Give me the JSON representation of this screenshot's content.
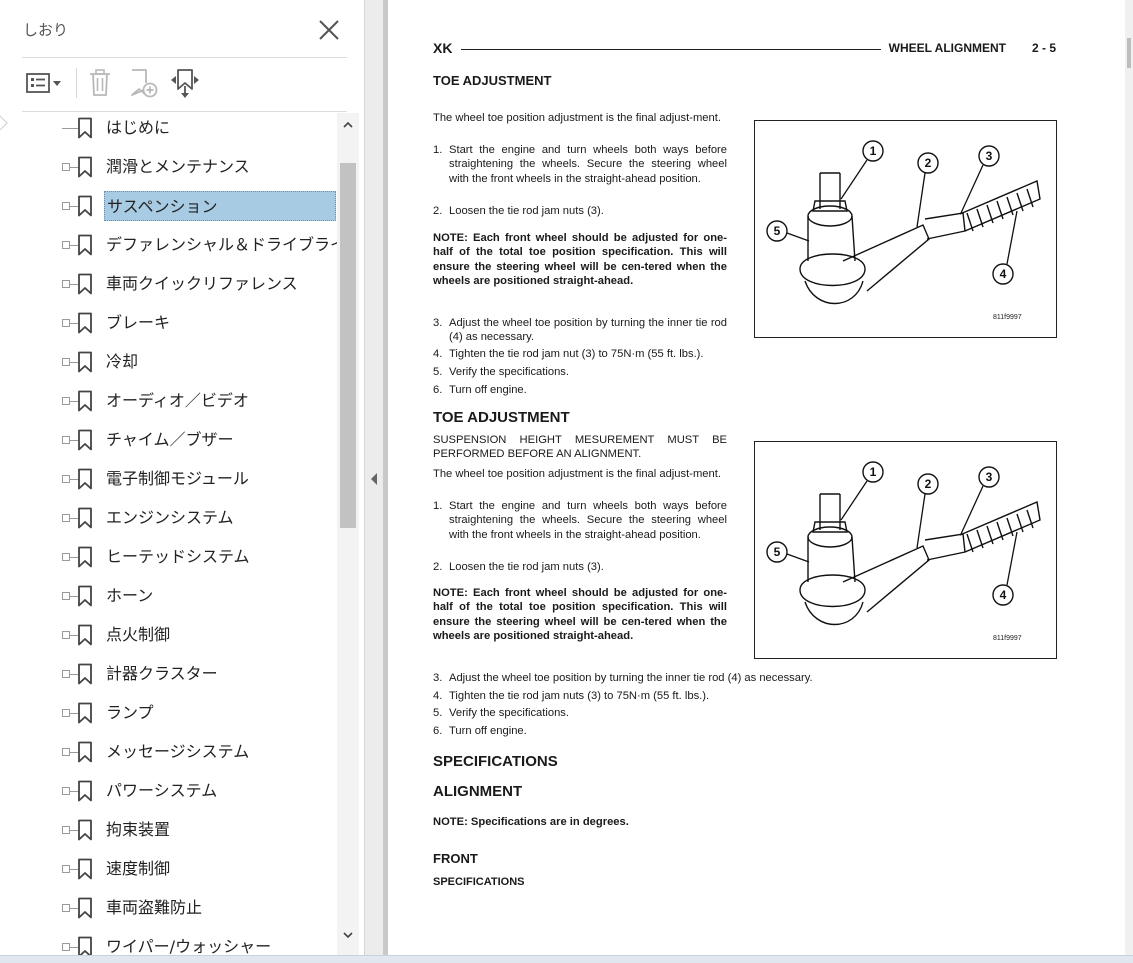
{
  "bookmarks_panel": {
    "title": "しおり",
    "toolbar": {
      "options_icon": "list-options-icon",
      "delete_icon": "trash-icon",
      "new_bookmark_icon": "new-bookmark-icon",
      "expand_icon": "bookmark-expand-icon"
    },
    "items": [
      {
        "label": "はじめに",
        "selected": false
      },
      {
        "label": "潤滑とメンテナンス",
        "selected": false
      },
      {
        "label": "サスペンション",
        "selected": true
      },
      {
        "label": "デファレンシャル＆ドライブライン",
        "selected": false
      },
      {
        "label": "車両クイックリファレンス",
        "selected": false
      },
      {
        "label": "ブレーキ",
        "selected": false
      },
      {
        "label": "冷却",
        "selected": false
      },
      {
        "label": "オーディオ／ビデオ",
        "selected": false
      },
      {
        "label": "チャイム／ブザー",
        "selected": false
      },
      {
        "label": "電子制御モジュール",
        "selected": false
      },
      {
        "label": "エンジンシステム",
        "selected": false
      },
      {
        "label": "ヒーテッドシステム",
        "selected": false
      },
      {
        "label": "ホーン",
        "selected": false
      },
      {
        "label": "点火制御",
        "selected": false
      },
      {
        "label": "計器クラスター",
        "selected": false
      },
      {
        "label": "ランプ",
        "selected": false
      },
      {
        "label": "メッセージシステム",
        "selected": false
      },
      {
        "label": "パワーシステム",
        "selected": false
      },
      {
        "label": "拘束装置",
        "selected": false
      },
      {
        "label": "速度制御",
        "selected": false
      },
      {
        "label": "車両盗難防止",
        "selected": false
      },
      {
        "label": "ワイパー/ウォッシャー",
        "selected": false
      }
    ]
  },
  "document": {
    "header": {
      "model": "XK",
      "section": "WHEEL ALIGNMENT",
      "page": "2 - 5"
    },
    "section1": {
      "heading": "TOE ADJUSTMENT",
      "intro": "The wheel toe position adjustment is the final adjust-ment.",
      "steps_a": [
        {
          "n": "1.",
          "text": "Start the engine and turn wheels both ways before straightening the wheels. Secure the steering wheel with the front wheels in the straight-ahead position."
        },
        {
          "n": "2.",
          "text": "Loosen the tie rod jam nuts (3)."
        }
      ],
      "note": "NOTE: Each front wheel should be adjusted for one-half of the total toe position specification. This will ensure the steering wheel will be cen-tered when the wheels are positioned straight-ahead.",
      "steps_b": [
        {
          "n": "3.",
          "text": "Adjust the wheel toe position by turning the inner tie rod (4) as necessary."
        },
        {
          "n": "4.",
          "text": "Tighten the tie rod jam nut (3) to 75N·m (55 ft. lbs.)."
        },
        {
          "n": "5.",
          "text": "Verify the specifications."
        },
        {
          "n": "6.",
          "text": "Turn off engine."
        }
      ],
      "figure_code": "811f9997"
    },
    "section2": {
      "heading": "TOE ADJUSTMENT",
      "warning": "SUSPENSION HEIGHT MESUREMENT MUST BE PERFORMED BEFORE AN ALIGNMENT.",
      "intro": "The wheel toe position adjustment is the final adjust-ment.",
      "steps_a": [
        {
          "n": "1.",
          "text": "Start the engine and turn wheels both ways before straightening the wheels. Secure the steering wheel with the front wheels in the straight-ahead position."
        },
        {
          "n": "2.",
          "text": "Loosen the tie rod jam nuts (3)."
        }
      ],
      "note": "NOTE: Each front wheel should be adjusted for one-half of the total toe position specification. This will ensure the steering wheel will be cen-tered when the wheels are positioned straight-ahead.",
      "steps_b": [
        {
          "n": "3.",
          "text": "Adjust the wheel toe position by turning the inner tie rod (4) as necessary."
        },
        {
          "n": "4.",
          "text": "Tighten the tie rod jam nuts (3) to 75N·m (55 ft. lbs.)."
        },
        {
          "n": "5.",
          "text": "Verify the specifications."
        },
        {
          "n": "6.",
          "text": "Turn off engine."
        }
      ],
      "figure_code": "811f9997"
    },
    "specs": {
      "heading": "SPECIFICATIONS",
      "sub": "ALIGNMENT",
      "note": "NOTE: Specifications are in degrees.",
      "front": "FRONT",
      "front_sub": "SPECIFICATIONS"
    },
    "callouts": [
      "1",
      "2",
      "3",
      "4",
      "5"
    ]
  },
  "colors": {
    "selection": "#a8cbe4",
    "panel_bg": "#ffffff",
    "splitter": "#ececec"
  }
}
